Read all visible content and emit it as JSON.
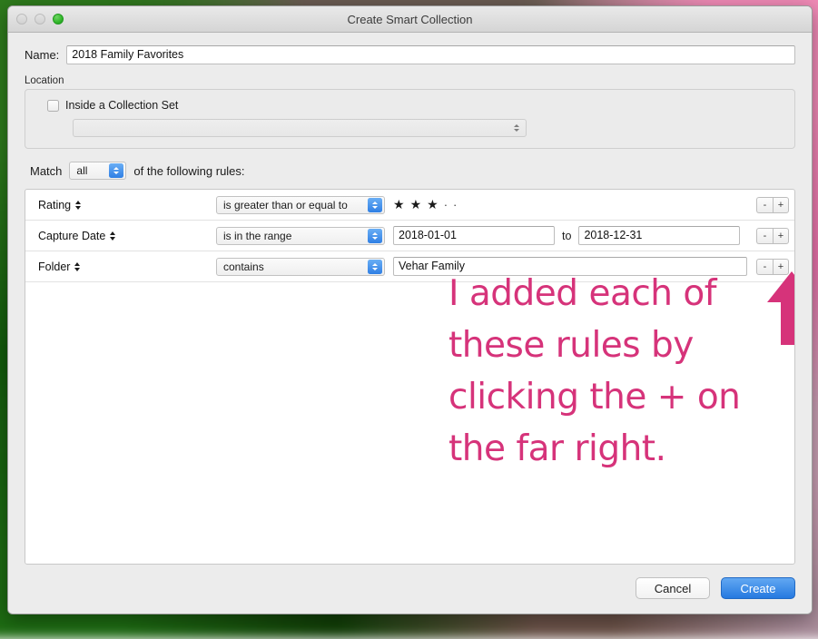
{
  "window": {
    "title": "Create Smart Collection",
    "traffic_lights": [
      {
        "name": "close",
        "state": "disabled"
      },
      {
        "name": "minimize",
        "state": "disabled"
      },
      {
        "name": "zoom",
        "state": "active",
        "color": "#34b82c"
      }
    ]
  },
  "name_section": {
    "label": "Name:",
    "value": "2018 Family Favorites",
    "placeholder": ""
  },
  "location_section": {
    "legend": "Location",
    "checkbox_label": "Inside a Collection Set",
    "checkbox_checked": false,
    "collection_set_value": ""
  },
  "match_section": {
    "prefix": "Match",
    "selected": "all",
    "suffix": "of the following rules:"
  },
  "rules": [
    {
      "field": "Rating",
      "operator": "is greater than or equal to",
      "value_type": "stars",
      "stars_filled": 3,
      "stars_empty": 2,
      "star_glyph": "★",
      "empty_glyph": "·",
      "remove_label": "-",
      "add_label": "+"
    },
    {
      "field": "Capture Date",
      "operator": "is in the range",
      "value_type": "date_range",
      "value_from": "2018-01-01",
      "range_separator": "to",
      "value_to": "2018-12-31",
      "remove_label": "-",
      "add_label": "+"
    },
    {
      "field": "Folder",
      "operator": "contains",
      "value_type": "text",
      "value": "Vehar Family",
      "remove_label": "-",
      "add_label": "+"
    }
  ],
  "annotation": {
    "text": "I added each of these rules by clicking the + on the far right.",
    "color": "#d6337a",
    "arrow_direction": "up"
  },
  "footer": {
    "cancel_label": "Cancel",
    "create_label": "Create",
    "accent_color": "#2579e0"
  }
}
